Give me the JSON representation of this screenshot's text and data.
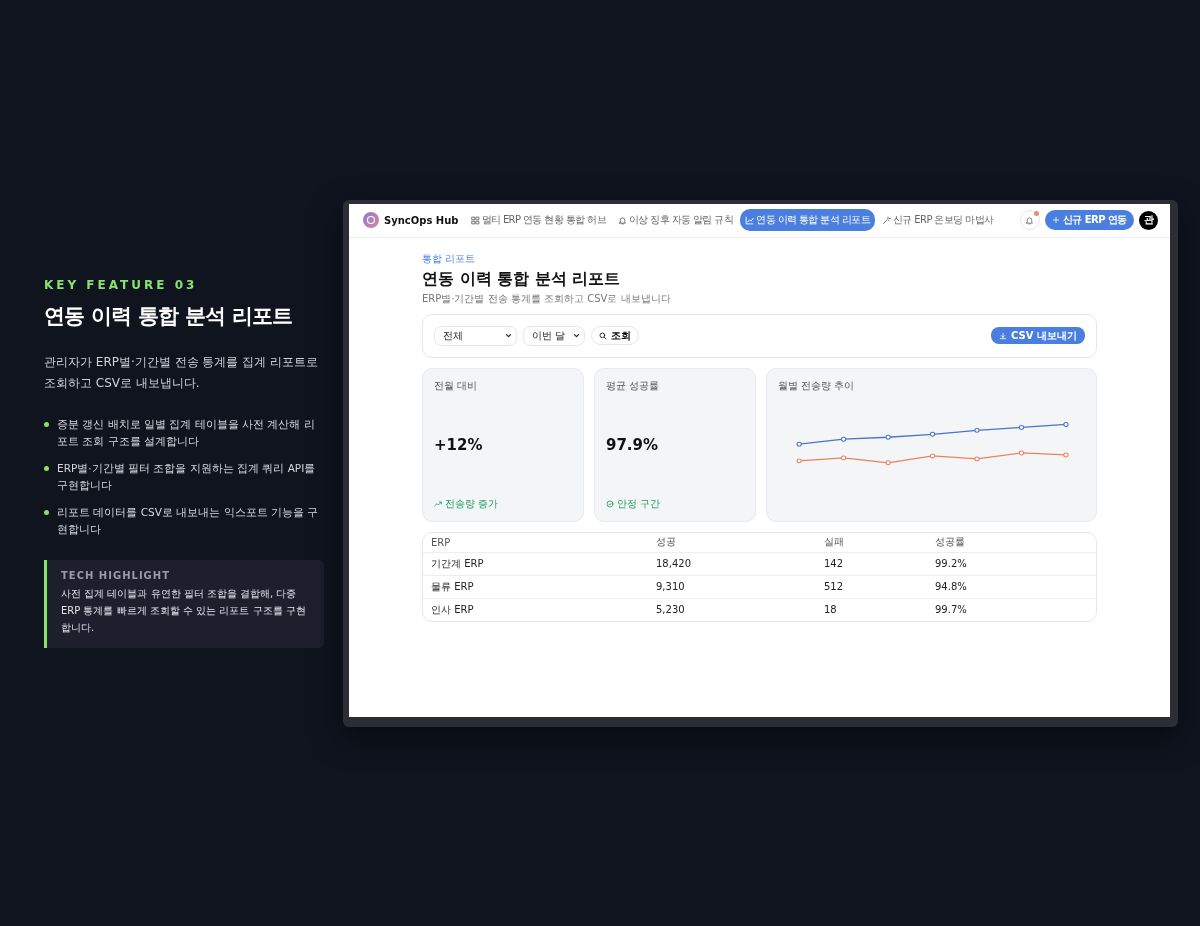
{
  "feature": {
    "eyebrow": "KEY FEATURE 03",
    "title": "연동 이력 통합 분석 리포트",
    "description": "관리자가 ERP별·기간별 전송 통계를 집계 리포트로 조회하고 CSV로 내보냅니다.",
    "bullets": [
      "증분 갱신 배치로 일별 집계 테이블을 사전 계산해 리포트 조회 구조를 설계합니다",
      "ERP별·기간별 필터 조합을 지원하는 집계 쿼리 API를 구현합니다",
      "리포트 데이터를 CSV로 내보내는 익스포트 기능을 구현합니다"
    ],
    "highlight": {
      "label": "TECH HIGHLIGHT",
      "text": "사전 집계 테이블과 유연한 필터 조합을 결합해, 다중 ERP 통계를 빠르게 조회할 수 있는 리포트 구조를 구현합니다."
    }
  },
  "app": {
    "brand": "SyncOps Hub",
    "nav": [
      {
        "label": "멀티 ERP 연동 현황 통합 허브",
        "selected": false
      },
      {
        "label": "이상 징후 자동 알림 규칙",
        "selected": false
      },
      {
        "label": "연동 이력 통합 분석 리포트",
        "selected": true
      },
      {
        "label": "신규 ERP 온보딩 마법사",
        "selected": false
      }
    ],
    "notifications_unread": true,
    "new_button": "신규 ERP 연동",
    "avatar": "관",
    "breadcrumb": "통합 리포트",
    "title": "연동 이력 통합 분석 리포트",
    "subtitle": "ERP별·기간별 전송 통계를 조회하고 CSV로 내보냅니다",
    "filters": {
      "erp": "전체",
      "period": "이번 달",
      "search_button": "조회",
      "export_button": "CSV 내보내기"
    },
    "stats": [
      {
        "label": "전월 대비",
        "value": "+12%",
        "note": "전송량 증가"
      },
      {
        "label": "평균 성공률",
        "value": "97.9%",
        "note": "안정 구간"
      }
    ],
    "trend_card": {
      "title": "월별 전송량 추이"
    },
    "table": {
      "columns": [
        "ERP",
        "성공",
        "실패",
        "성공률"
      ],
      "rows": [
        [
          "기간계 ERP",
          "18,420",
          "142",
          "99.2%"
        ],
        [
          "물류 ERP",
          "9,310",
          "512",
          "94.8%"
        ],
        [
          "인사 ERP",
          "5,230",
          "18",
          "99.7%"
        ]
      ]
    }
  }
}
